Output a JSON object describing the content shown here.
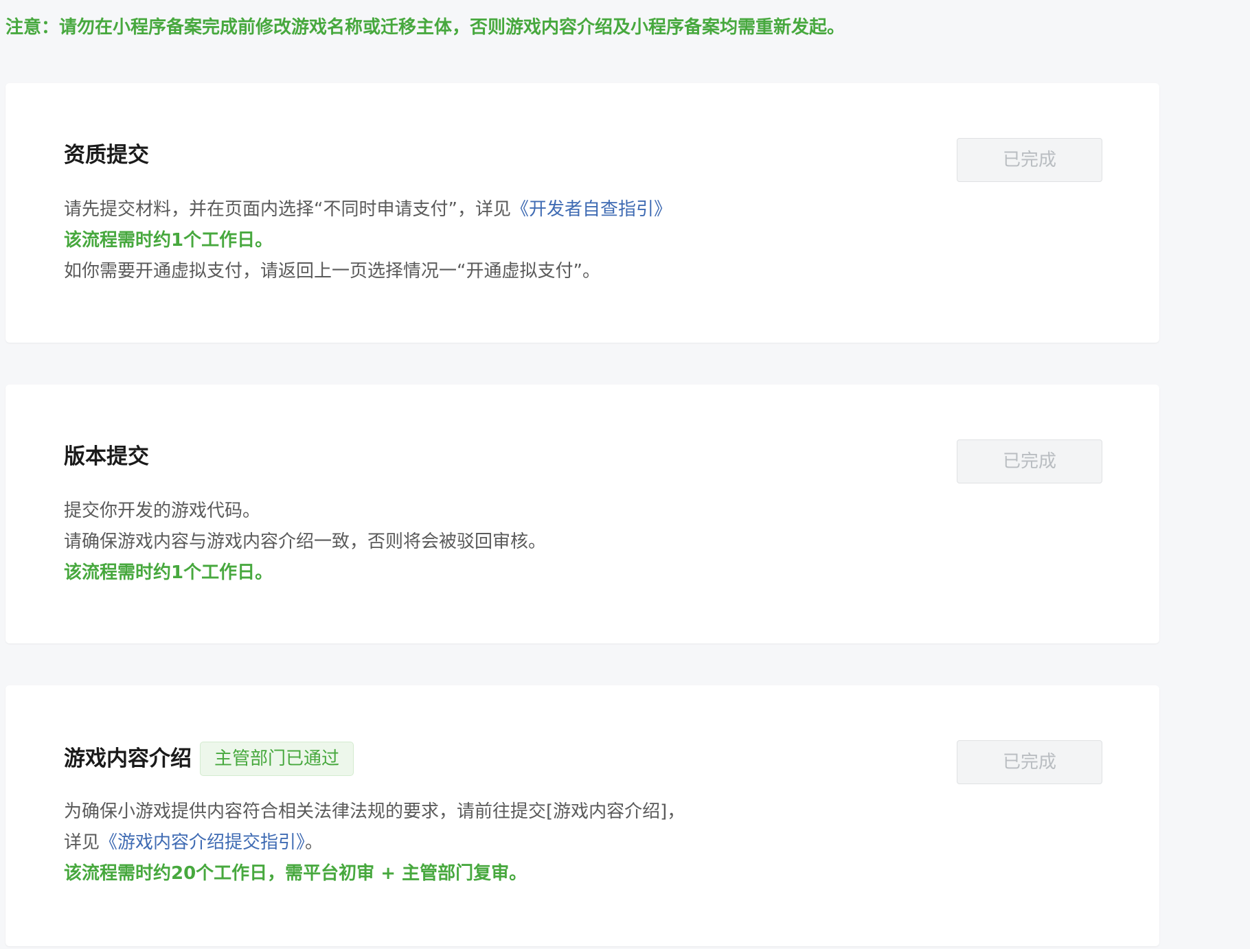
{
  "notice": "注意：请勿在小程序备案完成前修改游戏名称或迁移主体，否则游戏内容介绍及小程序备案均需重新发起。",
  "colors": {
    "accent_green": "#47a83e",
    "link_blue": "#3f6bb3",
    "page_bg": "#f6f7f9",
    "card_bg": "#ffffff",
    "disabled_button_bg": "#f3f4f5",
    "disabled_button_text": "#b9bdc1"
  },
  "cards": [
    {
      "title": "资质提交",
      "status_button": "已完成",
      "lines": {
        "l1_prefix": "请先提交材料，并在页面内选择“不同时申请支付”，详见",
        "l1_link": "《开发者自查指引》",
        "l2": "该流程需时约1个工作日。",
        "l3": "如你需要开通虚拟支付，请返回上一页选择情况一“开通虚拟支付”。"
      }
    },
    {
      "title": "版本提交",
      "status_button": "已完成",
      "lines": {
        "l1": "提交你开发的游戏代码。",
        "l2": "请确保游戏内容与游戏内容介绍一致，否则将会被驳回审核。",
        "l3": "该流程需时约1个工作日。"
      }
    },
    {
      "title": "游戏内容介绍",
      "tag": "主管部门已通过",
      "status_button": "已完成",
      "lines": {
        "l1": "为确保小游戏提供内容符合相关法律法规的要求，请前往提交[游戏内容介绍]，",
        "l2_prefix": "详见",
        "l2_link": "《游戏内容介绍提交指引》",
        "l2_suffix": "。",
        "l3": "该流程需时约20个工作日，需平台初审 + 主管部门复审。"
      }
    }
  ]
}
